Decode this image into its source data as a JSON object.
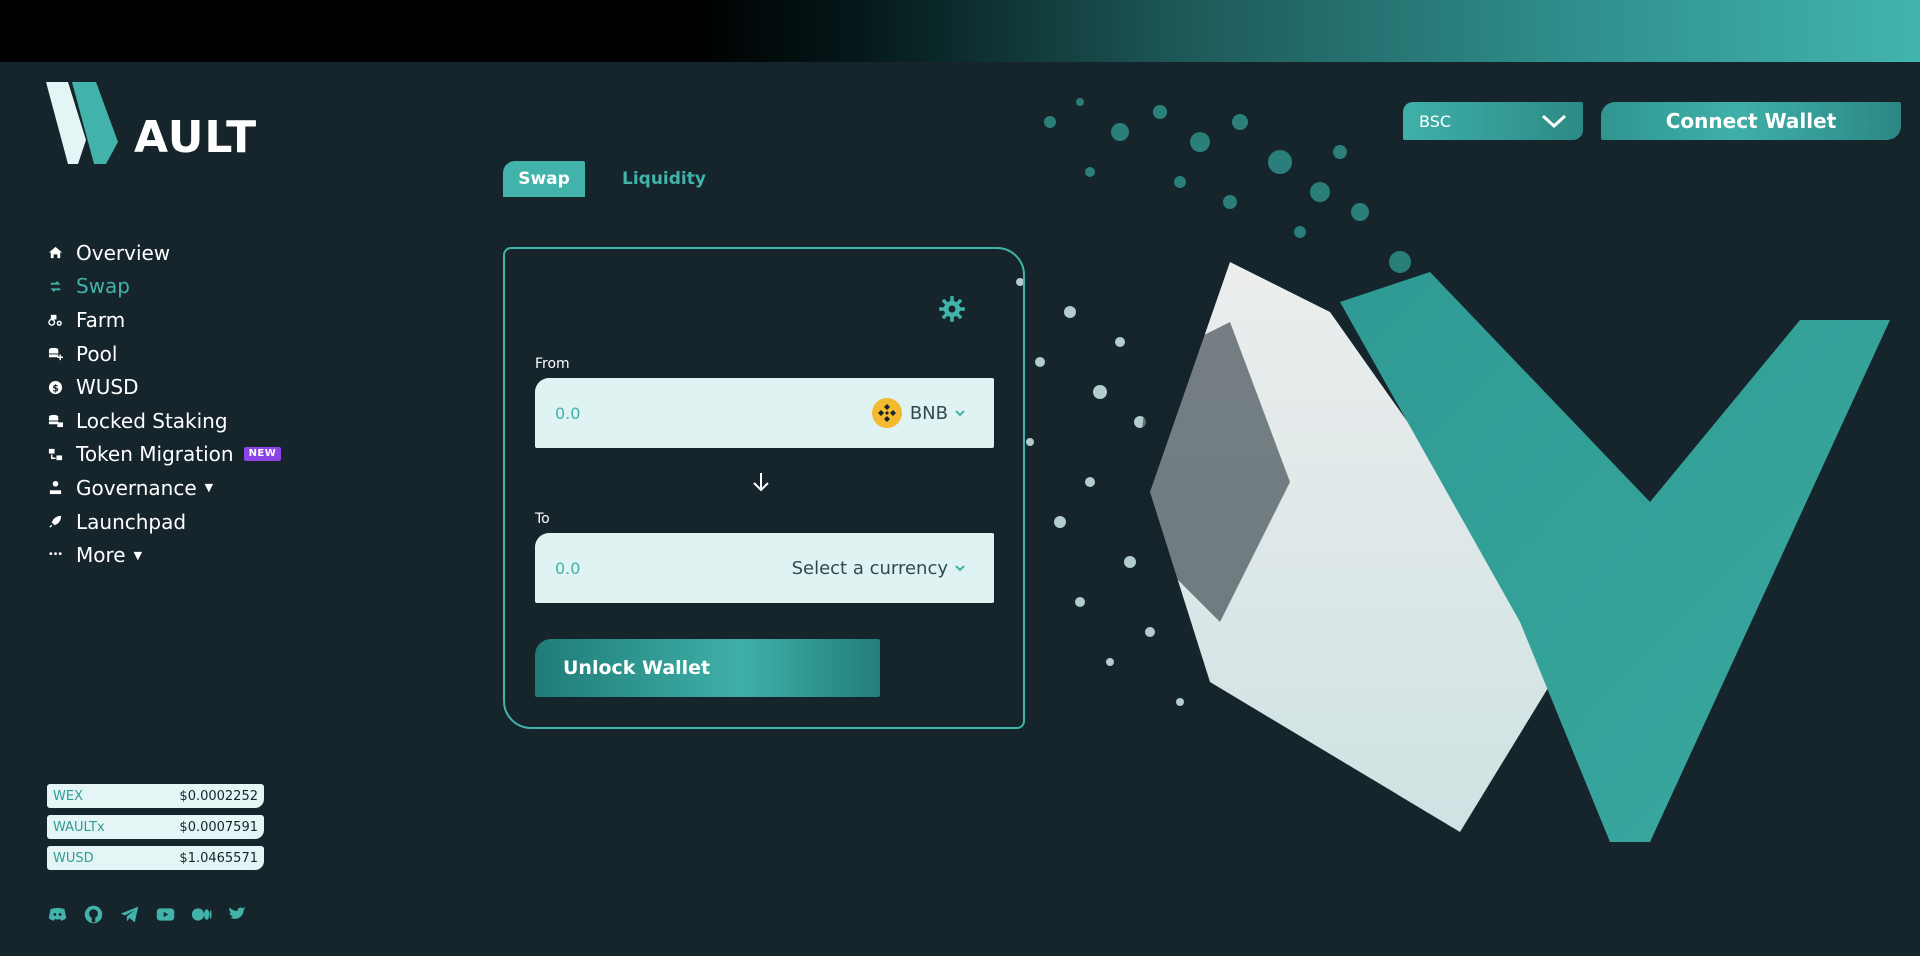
{
  "brand": {
    "logo_text": "AULT"
  },
  "nav": {
    "items": [
      {
        "label": "Overview",
        "icon": "home-icon",
        "active": false
      },
      {
        "label": "Swap",
        "icon": "swap-icon",
        "active": true
      },
      {
        "label": "Farm",
        "icon": "tractor-icon",
        "active": false
      },
      {
        "label": "Pool",
        "icon": "coins-plus-icon",
        "active": false
      },
      {
        "label": "WUSD",
        "icon": "dollar-coin-icon",
        "active": false
      },
      {
        "label": "Locked Staking",
        "icon": "coins-lock-icon",
        "active": false
      },
      {
        "label": "Token Migration",
        "icon": "migration-icon",
        "active": false,
        "badge": "NEW"
      },
      {
        "label": "Governance",
        "icon": "governance-icon",
        "active": false,
        "dropdown": true
      },
      {
        "label": "Launchpad",
        "icon": "rocket-icon",
        "active": false
      },
      {
        "label": "More",
        "icon": "more-icon",
        "active": false,
        "dropdown": true
      }
    ]
  },
  "prices": [
    {
      "name": "WEX",
      "value": "$0.0002252"
    },
    {
      "name": "WAULTx",
      "value": "$0.0007591"
    },
    {
      "name": "WUSD",
      "value": "$1.0465571"
    }
  ],
  "socials": [
    "discord-icon",
    "github-icon",
    "telegram-icon",
    "youtube-icon",
    "medium-icon",
    "twitter-icon"
  ],
  "header": {
    "network": "BSC",
    "connect_label": "Connect Wallet"
  },
  "tabs": {
    "swap": "Swap",
    "liquidity": "Liquidity"
  },
  "swap": {
    "from_label": "From",
    "from_placeholder": "0.0",
    "from_token": "BNB",
    "to_label": "To",
    "to_placeholder": "0.0",
    "to_token": "Select a currency",
    "unlock_label": "Unlock Wallet"
  },
  "colors": {
    "accent": "#41b3aa",
    "background": "#16252b",
    "input_bg": "#e0f3f3",
    "badge": "#8b44e6",
    "bnb": "#f3ba2f"
  }
}
